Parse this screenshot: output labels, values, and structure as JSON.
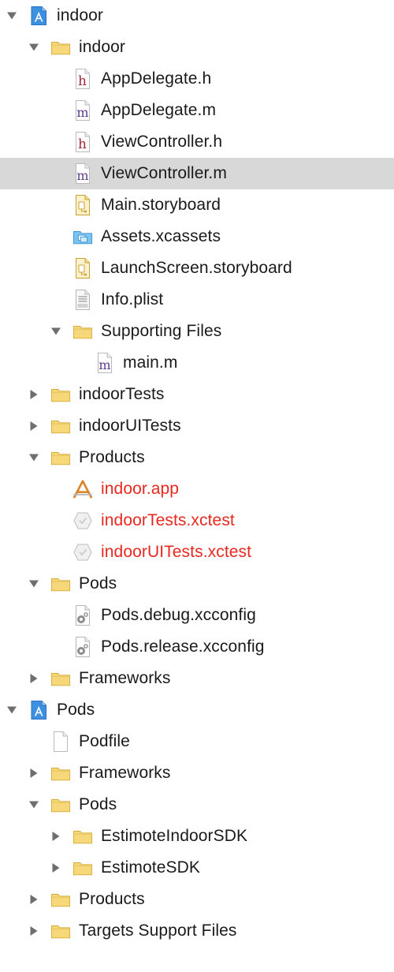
{
  "tree": [
    {
      "label": "indoor",
      "icon": "xcode-project-icon",
      "level": 0,
      "disclosure": "expanded"
    },
    {
      "label": "indoor",
      "icon": "folder-icon",
      "level": 1,
      "disclosure": "expanded"
    },
    {
      "label": "AppDelegate.h",
      "icon": "header-file-icon",
      "level": 2,
      "disclosure": "none"
    },
    {
      "label": "AppDelegate.m",
      "icon": "objc-source-file-icon",
      "level": 2,
      "disclosure": "none"
    },
    {
      "label": "ViewController.h",
      "icon": "header-file-icon",
      "level": 2,
      "disclosure": "none"
    },
    {
      "label": "ViewController.m",
      "icon": "objc-source-file-icon",
      "level": 2,
      "disclosure": "none",
      "selected": true
    },
    {
      "label": "Main.storyboard",
      "icon": "storyboard-file-icon",
      "level": 2,
      "disclosure": "none"
    },
    {
      "label": "Assets.xcassets",
      "icon": "asset-catalog-icon",
      "level": 2,
      "disclosure": "none"
    },
    {
      "label": "LaunchScreen.storyboard",
      "icon": "storyboard-file-icon",
      "level": 2,
      "disclosure": "none"
    },
    {
      "label": "Info.plist",
      "icon": "plist-file-icon",
      "level": 2,
      "disclosure": "none"
    },
    {
      "label": "Supporting Files",
      "icon": "folder-icon",
      "level": 2,
      "disclosure": "expanded"
    },
    {
      "label": "main.m",
      "icon": "objc-source-file-icon",
      "level": 3,
      "disclosure": "none"
    },
    {
      "label": "indoorTests",
      "icon": "folder-icon",
      "level": 1,
      "disclosure": "collapsed"
    },
    {
      "label": "indoorUITests",
      "icon": "folder-icon",
      "level": 1,
      "disclosure": "collapsed"
    },
    {
      "label": "Products",
      "icon": "folder-icon",
      "level": 1,
      "disclosure": "expanded"
    },
    {
      "label": "indoor.app",
      "icon": "app-product-icon",
      "level": 2,
      "disclosure": "none",
      "missing": true
    },
    {
      "label": "indoorTests.xctest",
      "icon": "xctest-bundle-icon",
      "level": 2,
      "disclosure": "none",
      "missing": true
    },
    {
      "label": "indoorUITests.xctest",
      "icon": "xctest-bundle-icon",
      "level": 2,
      "disclosure": "none",
      "missing": true
    },
    {
      "label": "Pods",
      "icon": "folder-icon",
      "level": 1,
      "disclosure": "expanded"
    },
    {
      "label": "Pods.debug.xcconfig",
      "icon": "xcconfig-file-icon",
      "level": 2,
      "disclosure": "none"
    },
    {
      "label": "Pods.release.xcconfig",
      "icon": "xcconfig-file-icon",
      "level": 2,
      "disclosure": "none"
    },
    {
      "label": "Frameworks",
      "icon": "folder-icon",
      "level": 1,
      "disclosure": "collapsed"
    },
    {
      "label": "Pods",
      "icon": "xcode-project-icon",
      "level": 0,
      "disclosure": "expanded"
    },
    {
      "label": "Podfile",
      "icon": "generic-file-icon",
      "level": 1,
      "disclosure": "none"
    },
    {
      "label": "Frameworks",
      "icon": "folder-icon",
      "level": 1,
      "disclosure": "collapsed"
    },
    {
      "label": "Pods",
      "icon": "folder-icon",
      "level": 1,
      "disclosure": "expanded"
    },
    {
      "label": "EstimoteIndoorSDK",
      "icon": "folder-icon",
      "level": 2,
      "disclosure": "collapsed"
    },
    {
      "label": "EstimoteSDK",
      "icon": "folder-icon",
      "level": 2,
      "disclosure": "collapsed"
    },
    {
      "label": "Products",
      "icon": "folder-icon",
      "level": 1,
      "disclosure": "collapsed"
    },
    {
      "label": "Targets Support Files",
      "icon": "folder-icon",
      "level": 1,
      "disclosure": "collapsed"
    }
  ],
  "colors": {
    "selection": "#d8d8d8",
    "missing_text": "#e8281e",
    "folder_fill": "#f6d77a",
    "folder_stroke": "#d5ad3c",
    "disclosure": "#6e6e6e",
    "project_icon": "#3d8fe0"
  }
}
